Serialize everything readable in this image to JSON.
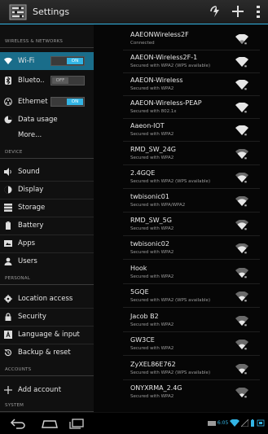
{
  "app": {
    "title": "Settings"
  },
  "toolbar": {
    "actions": [
      "lightning-wifi-icon",
      "add-icon",
      "overflow-menu-icon"
    ]
  },
  "left": {
    "sections": [
      {
        "header": "WIRELESS & NETWORKS"
      },
      {
        "header": "DEVICE"
      },
      {
        "header": "PERSONAL"
      },
      {
        "header": "ACCOUNTS"
      },
      {
        "header": "SYSTEM"
      }
    ],
    "items": {
      "wifi": {
        "label": "Wi-Fi",
        "toggle": "ON"
      },
      "bluetooth": {
        "label": "Blueto..",
        "toggle": "OFF"
      },
      "ethernet": {
        "label": "Ethernet",
        "toggle": "ON"
      },
      "data_usage": {
        "label": "Data usage"
      },
      "more": {
        "label": "More..."
      },
      "sound": {
        "label": "Sound"
      },
      "display": {
        "label": "Display"
      },
      "storage": {
        "label": "Storage"
      },
      "battery": {
        "label": "Battery"
      },
      "apps": {
        "label": "Apps"
      },
      "users": {
        "label": "Users"
      },
      "location": {
        "label": "Location access"
      },
      "security": {
        "label": "Security"
      },
      "language": {
        "label": "Language & input"
      },
      "backup": {
        "label": "Backup & reset"
      },
      "add_account": {
        "label": "Add account"
      }
    }
  },
  "networks": [
    {
      "ssid": "AAEONWireless2F",
      "status": "Connected"
    },
    {
      "ssid": "AAEON-Wireless2F-1",
      "status": "Secured with WPA2 (WPS available)"
    },
    {
      "ssid": "AAEON-Wireless",
      "status": "Secured with WPA2"
    },
    {
      "ssid": "AAEON-Wireless-PEAP",
      "status": "Secured with 802.1x"
    },
    {
      "ssid": "Aaeon-IOT",
      "status": "Secured with WPA2"
    },
    {
      "ssid": "RMD_SW_24G",
      "status": "Secured with WPA2"
    },
    {
      "ssid": "2.4GQE",
      "status": "Secured with WPA2 (WPS available)"
    },
    {
      "ssid": "twbisonic01",
      "status": "Secured with WPA/WPA2"
    },
    {
      "ssid": "RMD_SW_5G",
      "status": "Secured with WPA2"
    },
    {
      "ssid": "twbisonic02",
      "status": "Secured with WPA2"
    },
    {
      "ssid": "Hook",
      "status": "Secured with WPA2"
    },
    {
      "ssid": "5GQE",
      "status": "Secured with WPA2 (WPS available)"
    },
    {
      "ssid": "Jacob B2",
      "status": "Secured with WPA2"
    },
    {
      "ssid": "GW3CE",
      "status": "Secured with WPA2"
    },
    {
      "ssid": "ZyXEL86E762",
      "status": "Secured with WPA2 (WPS available)"
    },
    {
      "ssid": "ONYXRMA_2.4G",
      "status": "Secured with WPA2"
    }
  ],
  "navbar": {
    "time": "6:05",
    "buttons": [
      "back-icon",
      "home-icon",
      "recents-icon"
    ]
  },
  "colors": {
    "accent": "#33b5e5",
    "selected": "#1a6d8a"
  }
}
